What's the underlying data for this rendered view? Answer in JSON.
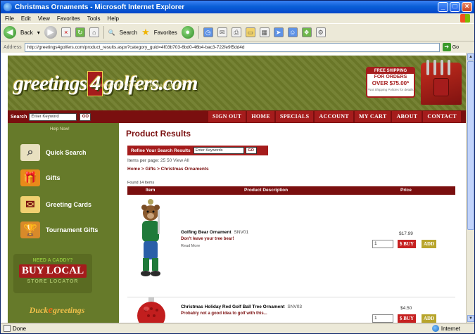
{
  "window": {
    "title": "Christmas Ornaments - Microsoft Internet Explorer"
  },
  "menu": [
    "File",
    "Edit",
    "View",
    "Favorites",
    "Tools",
    "Help"
  ],
  "toolbar": {
    "back_label": "Back",
    "search_label": "Search",
    "favorites_label": "Favorites"
  },
  "address": {
    "label": "Address",
    "url": "http://greetings4golfers.com/product_results.aspx?category_guid=4f03b703-6bd0-46b4-bac3-722fe9f5dd4d",
    "go_label": "Go"
  },
  "site": {
    "logo_text_left": "greetings",
    "logo_number": "4",
    "logo_text_right": "golfers.com",
    "tagline": "FEATURING YOUR FAVORITE GOLFERS & GOLF GIFTS",
    "promo": {
      "line1": "FREE SHIPPING",
      "line2": "FOR ORDERS",
      "line3": "OVER $75.00*",
      "line4": "*Not Shipping Policies for details"
    }
  },
  "nav": {
    "search_label": "Search",
    "search_placeholder": "Enter Keyword",
    "go_label": "GO",
    "links": [
      "SIGN OUT",
      "HOME",
      "SPECIALS",
      "ACCOUNT",
      "MY CART",
      "ABOUT",
      "CONTACT"
    ]
  },
  "sidebar": {
    "help": "Help Now!",
    "items": [
      {
        "label": "Quick Search",
        "icon": "magnifier-icon",
        "color": "#e8e0c0"
      },
      {
        "label": "Gifts",
        "icon": "gift-icon",
        "color": "#e88a1a"
      },
      {
        "label": "Greeting Cards",
        "icon": "envelope-icon",
        "color": "#f0d070"
      },
      {
        "label": "Tournament Gifts",
        "icon": "trophy-icon",
        "color": "#d88a2a"
      }
    ],
    "buylocal": {
      "need": "NEED A CADDY?",
      "buy": "BUY LOCAL",
      "store": "STORE LOCATOR"
    },
    "duck": {
      "left": "Duck",
      "e": "e",
      "right": "greetings"
    }
  },
  "main": {
    "title": "Product Results",
    "refine_label": "Refine Your Search Results",
    "refine_placeholder": "Enter Keywords",
    "refine_go": "GO",
    "perpage_label": "Items per page:",
    "perpage_options": [
      "25",
      "50",
      "View All"
    ],
    "breadcrumb": "Home > Gifts > Christmas Ornaments",
    "found": "Found 14 Items",
    "columns": [
      "Item",
      "Product Description",
      "Price"
    ],
    "products": [
      {
        "name": "Golfing Bear Ornament",
        "sku": "SNV01",
        "subtitle": "Don't leave your tree bear!",
        "readmore": "Read More",
        "price": "$17.99",
        "qty": "1",
        "buy": "$ BUY",
        "add": "ADD"
      },
      {
        "name": "Christmas Holiday Red Golf Ball Tree Ornament",
        "sku": "SNV03",
        "subtitle": "Probably not a good idea to golf with this...",
        "price": "$4.50",
        "qty": "1",
        "buy": "$ BUY",
        "add": "ADD"
      }
    ]
  },
  "status": {
    "left": "Done",
    "zone": "Internet"
  },
  "colors": {
    "brand_maroon": "#7a0f0f",
    "brand_red": "#a51c1c",
    "brand_olive": "#667a2a"
  }
}
